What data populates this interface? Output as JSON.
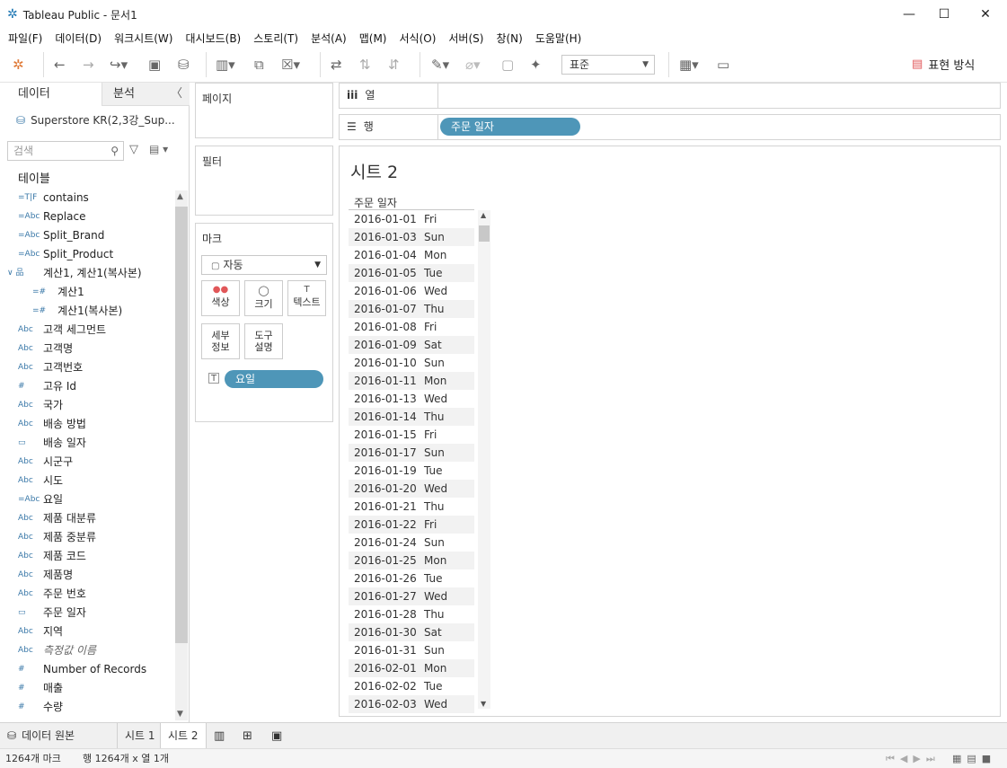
{
  "window": {
    "title": "Tableau Public - 문서1"
  },
  "menu": [
    "파일(F)",
    "데이터(D)",
    "워크시트(W)",
    "대시보드(B)",
    "스토리(T)",
    "분석(A)",
    "맵(M)",
    "서식(O)",
    "서버(S)",
    "창(N)",
    "도움말(H)"
  ],
  "toolbar": {
    "fit_value": "표준",
    "show_me_label": "표현 방식"
  },
  "left": {
    "tab_data": "데이터",
    "tab_analysis": "분석",
    "datasource": "Superstore KR(2,3강_Sup...",
    "search_placeholder": "검색",
    "tables_header": "테이블",
    "fields": [
      {
        "icon": "=T|F",
        "name": "contains"
      },
      {
        "icon": "=Abc",
        "name": "Replace"
      },
      {
        "icon": "=Abc",
        "name": "Split_Brand"
      },
      {
        "icon": "=Abc",
        "name": "Split_Product"
      },
      {
        "icon": "∨ 品",
        "name": "계산1, 계산1(복사본)"
      },
      {
        "icon": "=#",
        "name": "계산1",
        "indent": true
      },
      {
        "icon": "=#",
        "name": "계산1(복사본)",
        "indent": true
      },
      {
        "icon": "Abc",
        "name": "고객 세그먼트"
      },
      {
        "icon": "Abc",
        "name": "고객명"
      },
      {
        "icon": "Abc",
        "name": "고객번호"
      },
      {
        "icon": "#",
        "name": "고유 Id"
      },
      {
        "icon": "Abc",
        "name": "국가"
      },
      {
        "icon": "Abc",
        "name": "배송 방법"
      },
      {
        "icon": "▭",
        "name": "배송 일자"
      },
      {
        "icon": "Abc",
        "name": "시군구"
      },
      {
        "icon": "Abc",
        "name": "시도"
      },
      {
        "icon": "=Abc",
        "name": "요일"
      },
      {
        "icon": "Abc",
        "name": "제품 대분류"
      },
      {
        "icon": "Abc",
        "name": "제품 중분류"
      },
      {
        "icon": "Abc",
        "name": "제품 코드"
      },
      {
        "icon": "Abc",
        "name": "제품명"
      },
      {
        "icon": "Abc",
        "name": "주문 번호"
      },
      {
        "icon": "▭",
        "name": "주문 일자"
      },
      {
        "icon": "Abc",
        "name": "지역"
      },
      {
        "icon": "Abc",
        "name": "측정값 이름",
        "italic": true
      },
      {
        "icon": "#",
        "name": "Number of Records"
      },
      {
        "icon": "#",
        "name": "매출"
      },
      {
        "icon": "#",
        "name": "수량"
      }
    ]
  },
  "cards": {
    "pages": "페이지",
    "filters": "필터",
    "marks": "마크",
    "mark_type": "자동",
    "color": "색상",
    "size": "크기",
    "text": "텍스트",
    "detail": "세부\n정보",
    "tooltip": "도구\n설명",
    "text_pill": "요일"
  },
  "shelves": {
    "columns_label": "열",
    "rows_label": "행",
    "rows_pill": "주문 일자"
  },
  "view": {
    "sheet_title": "시트 2",
    "col_header": "주문 일자",
    "rows": [
      [
        "2016-01-01",
        "Fri"
      ],
      [
        "2016-01-03",
        "Sun"
      ],
      [
        "2016-01-04",
        "Mon"
      ],
      [
        "2016-01-05",
        "Tue"
      ],
      [
        "2016-01-06",
        "Wed"
      ],
      [
        "2016-01-07",
        "Thu"
      ],
      [
        "2016-01-08",
        "Fri"
      ],
      [
        "2016-01-09",
        "Sat"
      ],
      [
        "2016-01-10",
        "Sun"
      ],
      [
        "2016-01-11",
        "Mon"
      ],
      [
        "2016-01-13",
        "Wed"
      ],
      [
        "2016-01-14",
        "Thu"
      ],
      [
        "2016-01-15",
        "Fri"
      ],
      [
        "2016-01-17",
        "Sun"
      ],
      [
        "2016-01-19",
        "Tue"
      ],
      [
        "2016-01-20",
        "Wed"
      ],
      [
        "2016-01-21",
        "Thu"
      ],
      [
        "2016-01-22",
        "Fri"
      ],
      [
        "2016-01-24",
        "Sun"
      ],
      [
        "2016-01-25",
        "Mon"
      ],
      [
        "2016-01-26",
        "Tue"
      ],
      [
        "2016-01-27",
        "Wed"
      ],
      [
        "2016-01-28",
        "Thu"
      ],
      [
        "2016-01-30",
        "Sat"
      ],
      [
        "2016-01-31",
        "Sun"
      ],
      [
        "2016-02-01",
        "Mon"
      ],
      [
        "2016-02-02",
        "Tue"
      ],
      [
        "2016-02-03",
        "Wed"
      ]
    ]
  },
  "tabs": {
    "datasource": "데이터 원본",
    "sheet1": "시트 1",
    "sheet2": "시트 2"
  },
  "status": {
    "marks": "1264개 마크",
    "dims": "행 1264개  x  열 1개"
  }
}
